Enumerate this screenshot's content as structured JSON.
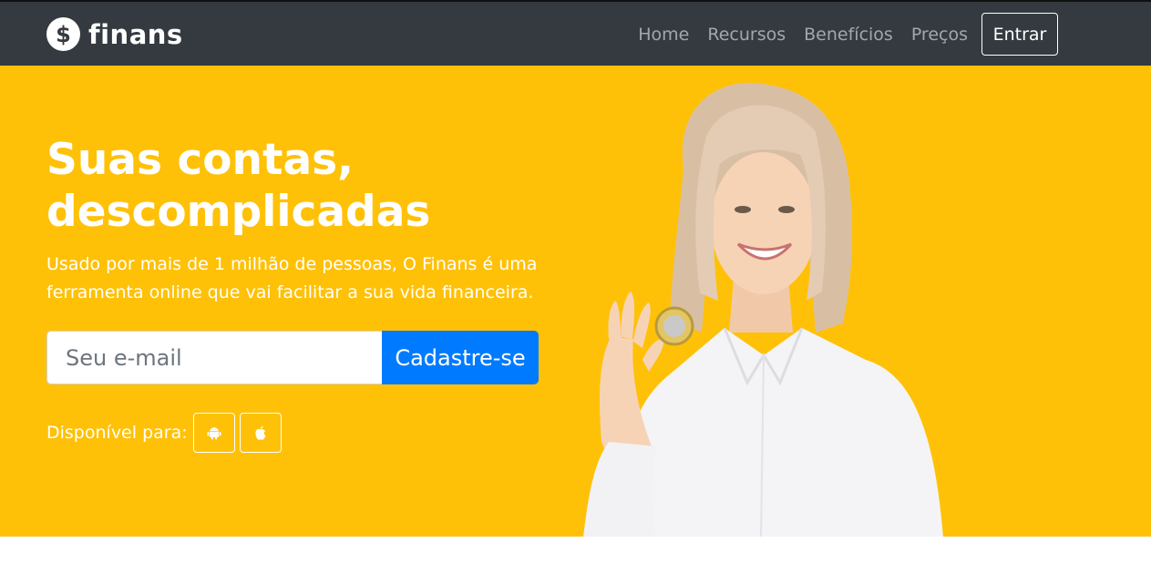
{
  "brand": {
    "icon_symbol": "$",
    "name": "finans",
    "icon": "dollar-circle-icon"
  },
  "nav": {
    "links": [
      "Home",
      "Recursos",
      "Benefícios",
      "Preços"
    ],
    "login_label": "Entrar"
  },
  "hero": {
    "title": "Suas contas, descomplicadas",
    "subtitle": "Usado por mais de 1 milhão de pessoas, O Finans é uma ferramenta online que vai facilitar a sua vida financeira.",
    "email_placeholder": "Seu e-mail",
    "email_value": "",
    "signup_label": "Cadastre-se",
    "available_label": "Disponível para:",
    "stores": [
      "android-icon",
      "apple-icon"
    ]
  },
  "colors": {
    "navbar": "#343a40",
    "hero_bg": "#ffc107",
    "primary": "#007bff",
    "text_light": "#ffffff"
  }
}
